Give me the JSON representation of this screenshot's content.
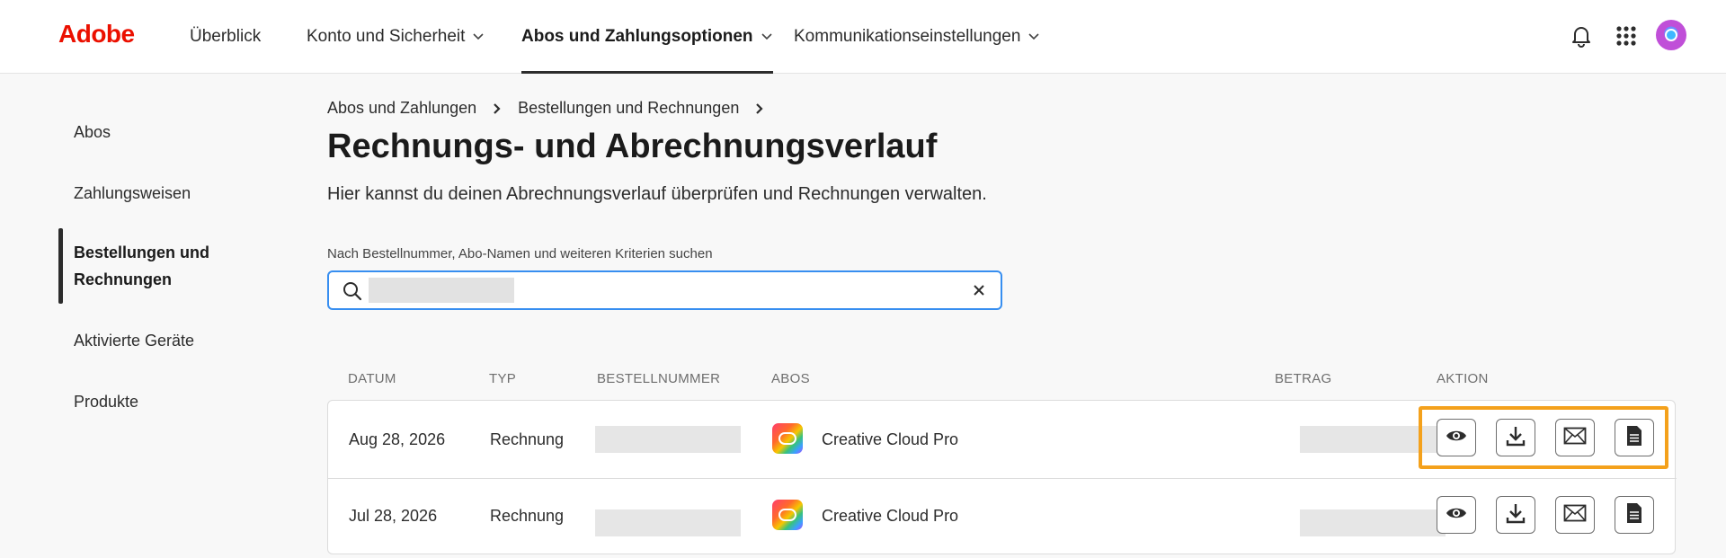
{
  "brand": {
    "logo_text": "Adobe",
    "logo_color": "#eb1000"
  },
  "nav": {
    "items": [
      {
        "label": "Überblick"
      },
      {
        "label": "Konto und Sicherheit"
      },
      {
        "label": "Abos und Zahlungsoptionen"
      },
      {
        "label": "Kommunikationseinstellungen"
      }
    ],
    "active_index": 2,
    "icons": [
      "bell-icon",
      "apps-grid-icon",
      "avatar"
    ]
  },
  "sidebar": {
    "items": [
      {
        "label": "Abos"
      },
      {
        "label": "Zahlungsweisen"
      },
      {
        "label": "Bestellungen und Rechnungen"
      },
      {
        "label": "Aktivierte Geräte"
      },
      {
        "label": "Produkte"
      }
    ],
    "active_index": 2
  },
  "breadcrumb": [
    {
      "label": "Abos und Zahlungen"
    },
    {
      "label": "Bestellungen und Rechnungen"
    }
  ],
  "page": {
    "title": "Rechnungs- und Abrechnungsverlauf",
    "subtitle": "Hier kannst du deinen Abrechnungsverlauf überprüfen und Rechnungen verwalten."
  },
  "search": {
    "label": "Nach Bestellnummer, Abo-Namen und weiteren Kriterien suchen",
    "value": "",
    "clear_icon": "close-icon"
  },
  "table": {
    "headers": {
      "date": "DATUM",
      "type": "TYP",
      "order": "BESTELLNUMMER",
      "plans": "ABOS",
      "amount": "BETRAG",
      "action": "AKTION"
    },
    "rows": [
      {
        "date": "Aug 28, 2026",
        "type": "Rechnung",
        "plan": "Creative Cloud Pro"
      },
      {
        "date": "Jul 28, 2026",
        "type": "Rechnung",
        "plan": "Creative Cloud Pro"
      }
    ],
    "actions": [
      "view-icon",
      "download-icon",
      "email-icon",
      "document-icon"
    ]
  },
  "colors": {
    "highlight": "#f4a11c",
    "focus": "#378ef0"
  }
}
